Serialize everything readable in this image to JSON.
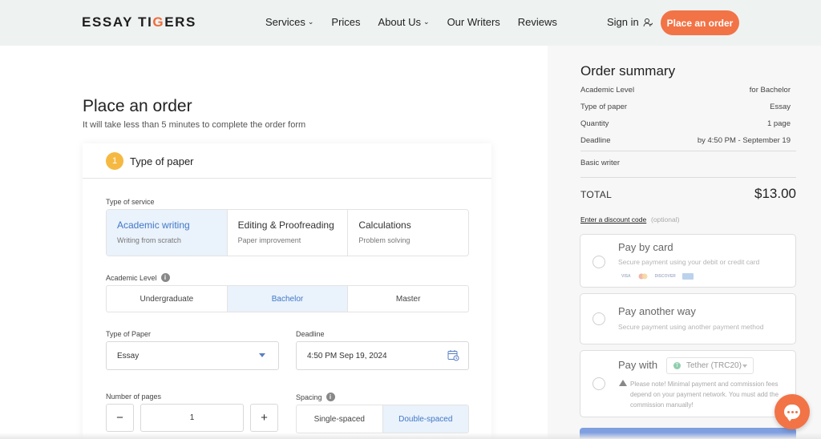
{
  "header": {
    "logo_part1": "ESSAY TI",
    "logo_accent": "G",
    "logo_part2": "ERS",
    "nav": [
      {
        "label": "Services",
        "has_dropdown": true
      },
      {
        "label": "Prices",
        "has_dropdown": false
      },
      {
        "label": "About Us",
        "has_dropdown": true
      },
      {
        "label": "Our Writers",
        "has_dropdown": false
      },
      {
        "label": "Reviews",
        "has_dropdown": false
      }
    ],
    "signin": "Sign in",
    "cta": "Place an order"
  },
  "main": {
    "title": "Place an order",
    "subtitle": "It will take less than 5 minutes to complete the order form",
    "step": {
      "number": "1",
      "title": "Type of paper"
    },
    "type_of_service": {
      "label": "Type of service",
      "options": [
        {
          "title": "Academic writing",
          "sub": "Writing from scratch",
          "selected": true
        },
        {
          "title": "Editing & Proofreading",
          "sub": "Paper improvement",
          "selected": false
        },
        {
          "title": "Calculations",
          "sub": "Problem solving",
          "selected": false
        }
      ]
    },
    "academic_level": {
      "label": "Academic Level",
      "options": [
        "Undergraduate",
        "Bachelor",
        "Master"
      ],
      "selected": "Bachelor"
    },
    "type_of_paper": {
      "label": "Type of Paper",
      "value": "Essay"
    },
    "deadline": {
      "label": "Deadline",
      "value": "4:50 PM Sep 19, 2024"
    },
    "pages": {
      "label": "Number of pages",
      "value": "1",
      "minus": "−",
      "plus": "+"
    },
    "spacing": {
      "label": "Spacing",
      "options": [
        "Single-spaced",
        "Double-spaced"
      ],
      "selected": "Double-spaced"
    }
  },
  "summary": {
    "title": "Order summary",
    "rows": [
      {
        "label": "Academic Level",
        "value": "for Bachelor"
      },
      {
        "label": "Type of paper",
        "value": "Essay"
      },
      {
        "label": "Quantity",
        "value": "1 page"
      },
      {
        "label": "Deadline",
        "value": "by 4:50 PM - September 19"
      }
    ],
    "writer": "Basic writer",
    "total_label": "TOTAL",
    "total_value": "$13.00",
    "discount_link": "Enter a discount code",
    "discount_optional": "(optional)",
    "payments": {
      "card": {
        "title": "Pay by card",
        "sub": "Secure payment using your debit or credit card",
        "logos": [
          "VISA",
          "MC",
          "DISCOVER",
          "AMEX"
        ]
      },
      "other": {
        "title": "Pay another way",
        "sub": "Secure payment using another payment method"
      },
      "crypto": {
        "title": "Pay with",
        "currency": "Tether (TRC20)",
        "note": "Please note! Minimal payment and commission fees depend on your payment network. You must add the commission manually!"
      }
    }
  },
  "colors": {
    "accent": "#f27346",
    "selected_bg": "#eaf2fb",
    "selected_text": "#3f78c8",
    "step_badge": "#f5b942"
  }
}
